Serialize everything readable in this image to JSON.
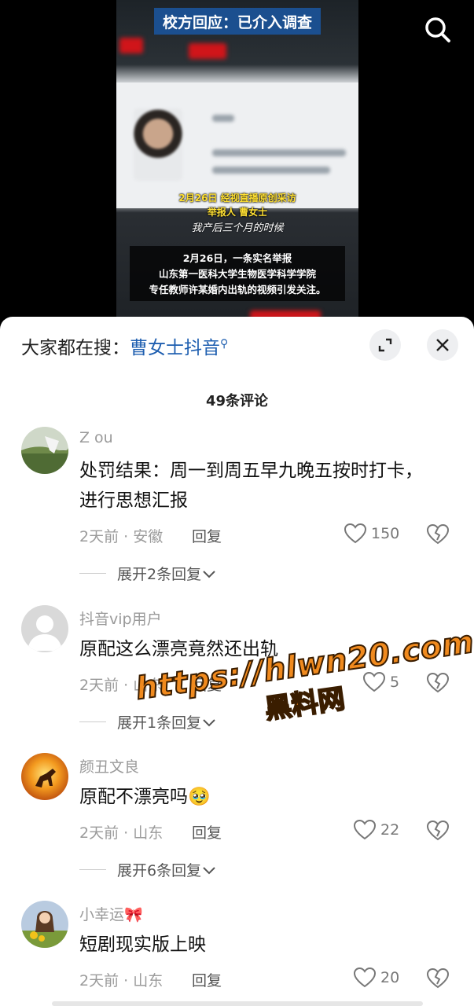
{
  "video": {
    "title": "校方回应：已介入调查",
    "caption_date": "2月26日 经视直播原创采访",
    "caption_reporter": "举报人 曹女士",
    "caption_quote": "我产后三个月的时候",
    "caption_box": [
      "2月26日，一条实名举报",
      "山东第一医科大学生物医学科学学院",
      "专任教师许某婚内出轨的视频引发关注。"
    ]
  },
  "search": {
    "prefix": "大家都在搜：",
    "keyword": "曹女士抖音"
  },
  "comments_count": "49条评论",
  "comments": [
    {
      "user": "Z ou",
      "text": "处罚结果：周一到周五早九晚五按时打卡，进行思想汇报",
      "meta": "2天前 · 安徽",
      "reply_label": "回复",
      "likes": "150",
      "expand": "展开2条回复"
    },
    {
      "user": "抖音vip用户",
      "text": "原配这么漂亮竟然还出轨",
      "meta": "2天前 · 山东",
      "reply_label": "回复",
      "likes": "5",
      "expand": "展开1条回复"
    },
    {
      "user": "颜丑文良",
      "text": "原配不漂亮吗🥹",
      "meta": "2天前 · 山东",
      "reply_label": "回复",
      "likes": "22",
      "expand": "展开6条回复"
    },
    {
      "user": "小幸运🎀",
      "text": "短剧现实版上映",
      "meta": "2天前 · 山东",
      "reply_label": "回复",
      "likes": "20"
    }
  ],
  "watermark": {
    "url": "https://hlwn20.com",
    "name": "黑料网"
  },
  "colors": {
    "keyword": "#1f5fb0",
    "title_bg": "#1b4f8f",
    "watermark": "#f08a1e"
  }
}
